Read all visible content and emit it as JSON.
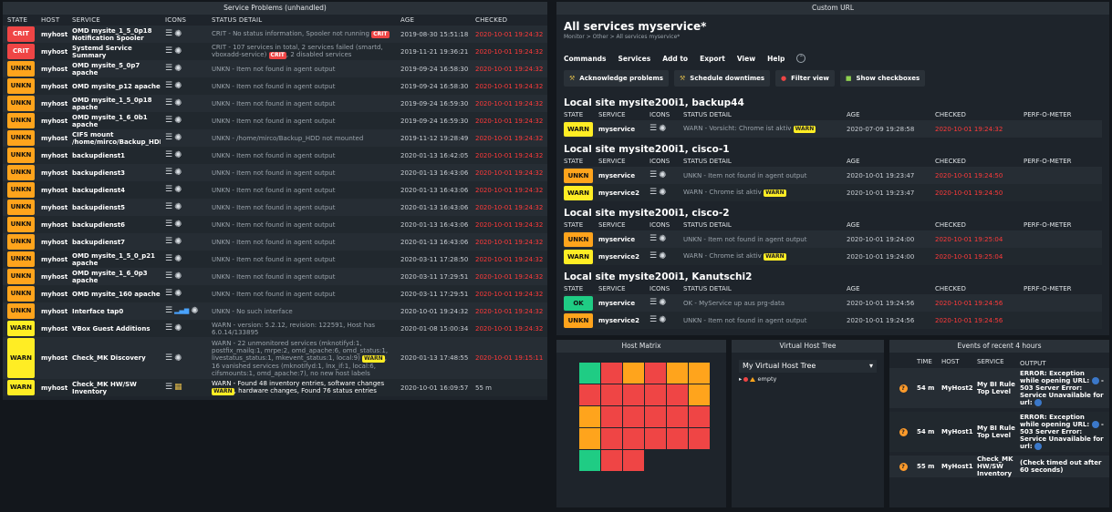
{
  "service_problems": {
    "title": "Service Problems (unhandled)",
    "columns": [
      "STATE",
      "HOST",
      "SERVICE",
      "ICONS",
      "STATUS DETAIL",
      "AGE",
      "CHECKED"
    ],
    "rows": [
      {
        "state": "CRIT",
        "host": "myhost",
        "service": "OMD mysite_1_5_0p18 Notification Spooler",
        "detail": "CRIT - No status information, Spooler not running",
        "pill": "CRIT",
        "detail_after": "",
        "age": "2019-08-30 15:51:18",
        "checked": "2020-10-01 19:24:32"
      },
      {
        "state": "CRIT",
        "host": "myhost",
        "service": "Systemd Service Summary",
        "detail": "CRIT - 107 services in total, 2 services failed (smartd, vboxadd-service)",
        "pill": "CRIT",
        "detail_after": ", 2 disabled services",
        "age": "2019-11-21 19:36:21",
        "checked": "2020-10-01 19:24:32"
      },
      {
        "state": "UNKN",
        "host": "myhost",
        "service": "OMD mysite_5_0p7 apache",
        "detail": "UNKN - Item not found in agent output",
        "pill": "",
        "detail_after": "",
        "age": "2019-09-24 16:58:30",
        "checked": "2020-10-01 19:24:32"
      },
      {
        "state": "UNKN",
        "host": "myhost",
        "service": "OMD mysite_p12 apache",
        "detail": "UNKN - Item not found in agent output",
        "pill": "",
        "detail_after": "",
        "age": "2019-09-24 16:58:30",
        "checked": "2020-10-01 19:24:32"
      },
      {
        "state": "UNKN",
        "host": "myhost",
        "service": "OMD mysite_1_5_0p18 apache",
        "detail": "UNKN - Item not found in agent output",
        "pill": "",
        "detail_after": "",
        "age": "2019-09-24 16:59:30",
        "checked": "2020-10-01 19:24:32"
      },
      {
        "state": "UNKN",
        "host": "myhost",
        "service": "OMD mysite_1_6_0b1 apache",
        "detail": "UNKN - Item not found in agent output",
        "pill": "",
        "detail_after": "",
        "age": "2019-09-24 16:59:30",
        "checked": "2020-10-01 19:24:32"
      },
      {
        "state": "UNKN",
        "host": "myhost",
        "service": "CIFS mount /home/mirco/Backup_HDD",
        "detail": "UNKN - /home/mirco/Backup_HDD not mounted",
        "pill": "",
        "detail_after": "",
        "age": "2019-11-12 19:28:49",
        "checked": "2020-10-01 19:24:32"
      },
      {
        "state": "UNKN",
        "host": "myhost",
        "service": "backupdienst1",
        "detail": "UNKN - Item not found in agent output",
        "pill": "",
        "detail_after": "",
        "age": "2020-01-13 16:42:05",
        "checked": "2020-10-01 19:24:32"
      },
      {
        "state": "UNKN",
        "host": "myhost",
        "service": "backupdienst3",
        "detail": "UNKN - Item not found in agent output",
        "pill": "",
        "detail_after": "",
        "age": "2020-01-13 16:43:06",
        "checked": "2020-10-01 19:24:32"
      },
      {
        "state": "UNKN",
        "host": "myhost",
        "service": "backupdienst4",
        "detail": "UNKN - Item not found in agent output",
        "pill": "",
        "detail_after": "",
        "age": "2020-01-13 16:43:06",
        "checked": "2020-10-01 19:24:32"
      },
      {
        "state": "UNKN",
        "host": "myhost",
        "service": "backupdienst5",
        "detail": "UNKN - Item not found in agent output",
        "pill": "",
        "detail_after": "",
        "age": "2020-01-13 16:43:06",
        "checked": "2020-10-01 19:24:32"
      },
      {
        "state": "UNKN",
        "host": "myhost",
        "service": "backupdienst6",
        "detail": "UNKN - Item not found in agent output",
        "pill": "",
        "detail_after": "",
        "age": "2020-01-13 16:43:06",
        "checked": "2020-10-01 19:24:32"
      },
      {
        "state": "UNKN",
        "host": "myhost",
        "service": "backupdienst7",
        "detail": "UNKN - Item not found in agent output",
        "pill": "",
        "detail_after": "",
        "age": "2020-01-13 16:43:06",
        "checked": "2020-10-01 19:24:32"
      },
      {
        "state": "UNKN",
        "host": "myhost",
        "service": "OMD mysite_1_5_0_p21 apache",
        "detail": "UNKN - Item not found in agent output",
        "pill": "",
        "detail_after": "",
        "age": "2020-03-11 17:28:50",
        "checked": "2020-10-01 19:24:32"
      },
      {
        "state": "UNKN",
        "host": "myhost",
        "service": "OMD mysite_1_6_0p3 apache",
        "detail": "UNKN - Item not found in agent output",
        "pill": "",
        "detail_after": "",
        "age": "2020-03-11 17:29:51",
        "checked": "2020-10-01 19:24:32"
      },
      {
        "state": "UNKN",
        "host": "myhost",
        "service": "OMD mysite_160 apache",
        "detail": "UNKN - Item not found in agent output",
        "pill": "",
        "detail_after": "",
        "age": "2020-03-11 17:29:51",
        "checked": "2020-10-01 19:24:32"
      },
      {
        "state": "UNKN",
        "host": "myhost",
        "service": "Interface tap0",
        "detail": "UNKN - No such interface",
        "pill": "",
        "detail_after": "",
        "age": "2020-10-01 19:24:32",
        "checked": "2020-10-01 19:24:32"
      },
      {
        "state": "WARN",
        "host": "myhost",
        "service": "VBox Guest Additions",
        "detail": "WARN - version: 5.2.12, revision: 122591, Host has 6.0.14/133895",
        "pill": "",
        "detail_after": "",
        "age": "2020-01-08 15:00:34",
        "checked": "2020-10-01 19:24:32"
      },
      {
        "state": "WARN",
        "host": "myhost",
        "service": "Check_MK Discovery",
        "detail": "WARN - 22 unmonitored services (mknotifyd:1, postfix_mailq:1, mrpe:2, omd_apache:6, omd_status:1, livestatus_status:1, mkevent_status:1, local:9)",
        "pill": "WARN",
        "detail_after": ", 16 vanished services (mknotifyd:1, lnx_if:1, local:6, cifsmounts:1, omd_apache:7), no new host labels",
        "age": "2020-01-13 17:48:55",
        "checked": "2020-10-01 19:15:11"
      },
      {
        "state": "WARN",
        "host": "myhost",
        "service": "Check_MK HW/SW Inventory",
        "detail": "WARN - Found 48 inventory entries, software changes",
        "pill": "WARN",
        "detail_after": ", hardware changes, Found 76 status entries",
        "age": "2020-10-01 16:09:57",
        "checked": "55 m"
      }
    ]
  },
  "custom_url": {
    "title": "Custom URL",
    "page_title": "All services myservice*",
    "breadcrumb": "Monitor > Other > All services myservice*",
    "menu": [
      "Commands",
      "Services",
      "Add to",
      "Export",
      "View",
      "Help"
    ],
    "buttons": [
      "Acknowledge problems",
      "Schedule downtimes",
      "Filter view",
      "Show checkboxes"
    ],
    "columns": [
      "STATE",
      "SERVICE",
      "ICONS",
      "STATUS DETAIL",
      "AGE",
      "CHECKED",
      "PERF-O-METER"
    ],
    "sites": [
      {
        "title": "Local site mysite200i1, backup44",
        "rows": [
          {
            "state": "WARN",
            "service": "myservice",
            "detail": "WARN - Vorsicht: Chrome ist aktiv",
            "pill": "WARN",
            "age": "2020-07-09 19:28:58",
            "checked": "2020-10-01 19:24:32"
          }
        ]
      },
      {
        "title": "Local site mysite200i1, cisco-1",
        "rows": [
          {
            "state": "UNKN",
            "service": "myservice",
            "detail": "UNKN - Item not found in agent output",
            "pill": "",
            "age": "2020-10-01 19:23:47",
            "checked": "2020-10-01 19:24:50"
          },
          {
            "state": "WARN",
            "service": "myservice2",
            "detail": "WARN - Chrome ist aktiv",
            "pill": "WARN",
            "age": "2020-10-01 19:23:47",
            "checked": "2020-10-01 19:24:50"
          }
        ]
      },
      {
        "title": "Local site mysite200i1, cisco-2",
        "rows": [
          {
            "state": "UNKN",
            "service": "myservice",
            "detail": "UNKN - Item not found in agent output",
            "pill": "",
            "age": "2020-10-01 19:24:00",
            "checked": "2020-10-01 19:25:04"
          },
          {
            "state": "WARN",
            "service": "myservice2",
            "detail": "WARN - Chrome ist aktiv",
            "pill": "WARN",
            "age": "2020-10-01 19:24:00",
            "checked": "2020-10-01 19:25:04"
          }
        ]
      },
      {
        "title": "Local site mysite200i1, Kanutschi2",
        "rows": [
          {
            "state": "OK",
            "service": "myservice",
            "detail": "OK - MyService up aus prg-data",
            "pill": "",
            "age": "2020-10-01 19:24:56",
            "checked": "2020-10-01 19:24:56"
          },
          {
            "state": "UNKN",
            "service": "myservice2",
            "detail": "UNKN - Item not found in agent output",
            "pill": "",
            "age": "2020-10-01 19:24:56",
            "checked": "2020-10-01 19:24:56"
          }
        ]
      }
    ]
  },
  "host_matrix": {
    "title": "Host Matrix",
    "cells": [
      "g",
      "r",
      "o",
      "r",
      "o",
      "o",
      "r",
      "r",
      "r",
      "r",
      "r",
      "o",
      "o",
      "r",
      "r",
      "r",
      "r",
      "r",
      "o",
      "r",
      "r",
      "r",
      "r",
      "r",
      "g",
      "r",
      "r",
      "n",
      "n",
      "n",
      "n",
      "n",
      "n",
      "n",
      "n",
      "n"
    ]
  },
  "virtual_host_tree": {
    "title": "Virtual Host Tree",
    "selected": "My Virtual Host Tree",
    "node": "empty"
  },
  "events": {
    "title": "Events of recent 4 hours",
    "columns": [
      "TIME",
      "HOST",
      "SERVICE",
      "OUTPUT"
    ],
    "rows": [
      {
        "time": "54 m",
        "host": "MyHost2",
        "service": "My BI Rule Top Level",
        "output_a": "ERROR: Exception while opening URL:",
        "output_b": "- 503 Server Error: Service Unavailable for url:"
      },
      {
        "time": "54 m",
        "host": "MyHost1",
        "service": "My BI Rule Top Level",
        "output_a": "ERROR: Exception while opening URL:",
        "output_b": "- 503 Server Error: Service Unavailable for url:"
      },
      {
        "time": "55 m",
        "host": "MyHost1",
        "service": "Check_MK HW/SW Inventory",
        "output_a": "(Check timed out after 60 seconds)",
        "output_b": ""
      }
    ]
  }
}
